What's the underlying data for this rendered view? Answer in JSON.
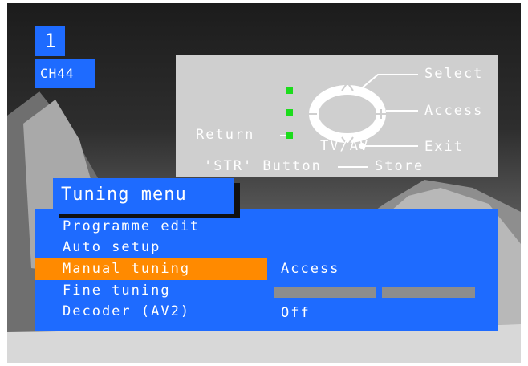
{
  "programme": {
    "number": "1",
    "channel": "CH44"
  },
  "help": {
    "select": "Select",
    "access": "Access",
    "return": "Return",
    "tvav": "TV/AV",
    "exit": "Exit",
    "str_button": "'STR' Button",
    "store": "Store",
    "icons": [
      "joystick-pad-icon",
      "arrow-up-icon",
      "arrow-down-icon",
      "minus-icon",
      "plus-icon"
    ]
  },
  "menu": {
    "title": "Tuning menu",
    "items": [
      {
        "label": "Programme edit",
        "value": ""
      },
      {
        "label": "Auto setup",
        "value": ""
      },
      {
        "label": "Manual tuning",
        "value": "Access",
        "selected": true
      },
      {
        "label": "Fine tuning",
        "value": ""
      },
      {
        "label": "Decoder (AV2)",
        "value": "Off"
      }
    ]
  },
  "colors": {
    "menu_blue": "#1e6bff",
    "highlight_orange": "#ff8a00",
    "indicator_green": "#1cdc1c",
    "help_panel": "#cfcfcf"
  }
}
